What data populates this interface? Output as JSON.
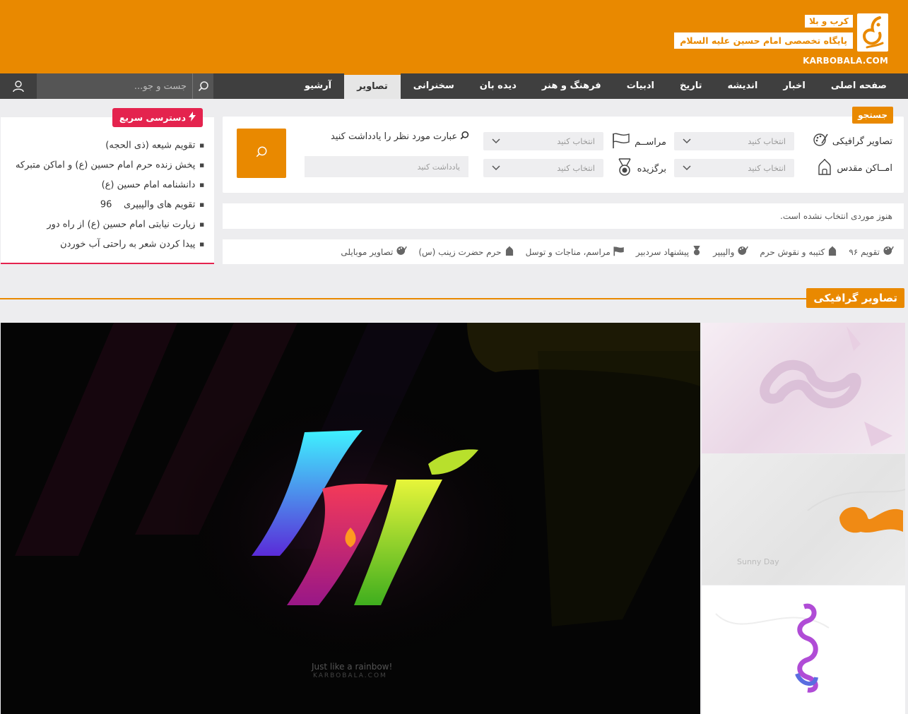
{
  "header": {
    "tag": "کرب و بلا",
    "subtitle": "پایگاه تخصصی امام حسین علیه السلام",
    "url": "KARBOBALA.COM",
    "logo_icon": "karbobala-calligraphy-logo"
  },
  "nav": {
    "items": [
      {
        "label": "صفحه اصلی",
        "active": false
      },
      {
        "label": "اخبار",
        "active": false
      },
      {
        "label": "اندیشه",
        "active": false
      },
      {
        "label": "تاریخ",
        "active": false
      },
      {
        "label": "ادبیات",
        "active": false
      },
      {
        "label": "فرهنگ و هنر",
        "active": false
      },
      {
        "label": "دیده بان",
        "active": false
      },
      {
        "label": "سخنرانی",
        "active": false
      },
      {
        "label": "تصاویر",
        "active": true
      },
      {
        "label": "آرشیو",
        "active": false
      }
    ],
    "search_placeholder": "جست و جو...",
    "search_icon": "search-icon",
    "user_icon": "user-icon"
  },
  "quick_access": {
    "title": "دسترسی سریع",
    "icon": "lightning-icon",
    "items": [
      "تقویم شیعه (ذی الحجه)",
      "پخش زنده حرم امام حسین (ع) و اماکن متبرکه",
      "دانشنامه امام حسین (ع)",
      "تقویم های والپیپری    96",
      "زیارت نیابتی امام حسین (ع) از راه دور",
      "پیدا کردن شعر به راحتی آب خوردن"
    ]
  },
  "search_panel": {
    "badge": "جستجو",
    "fields": {
      "graphic": {
        "label": "تصاویر گرافیکی",
        "placeholder": "انتخاب کنید"
      },
      "ceremony": {
        "label": "مراســم",
        "placeholder": "انتخاب کنید"
      },
      "holy_places": {
        "label": "امــاکن مقدس",
        "placeholder": "انتخاب کنید"
      },
      "featured": {
        "label": "برگزیده",
        "placeholder": "انتخاب کنید"
      }
    },
    "note_label": "عبارت مورد نظر را یادداشت کنید",
    "note_placeholder": "یادداشت کنید"
  },
  "selected_status": "هنوز موردی انتخاب نشده است.",
  "categories": [
    {
      "label": "تقویم ۹۶",
      "icon": "palette-icon"
    },
    {
      "label": "کتیبه و نقوش حرم",
      "icon": "shrine-icon"
    },
    {
      "label": "والپیپر",
      "icon": "palette-icon"
    },
    {
      "label": "پیشنهاد سردبیر",
      "icon": "medal-icon"
    },
    {
      "label": "مراسم، مناجات و توسل",
      "icon": "flag-icon"
    },
    {
      "label": "حرم حضرت زینب (س)",
      "icon": "shrine-icon"
    },
    {
      "label": "تصاویر موبایلی",
      "icon": "palette-icon"
    }
  ],
  "section": {
    "title": "تصاویر گرافیکی"
  },
  "gallery": {
    "main": {
      "caption": "Just like a rainbow!",
      "site": "KARBOBALA.COM"
    },
    "thumb2": {
      "caption": "Sunny Day"
    }
  },
  "colors": {
    "accent": "#e98900",
    "nav": "#3f3f3f",
    "quick": "#e4234e"
  }
}
